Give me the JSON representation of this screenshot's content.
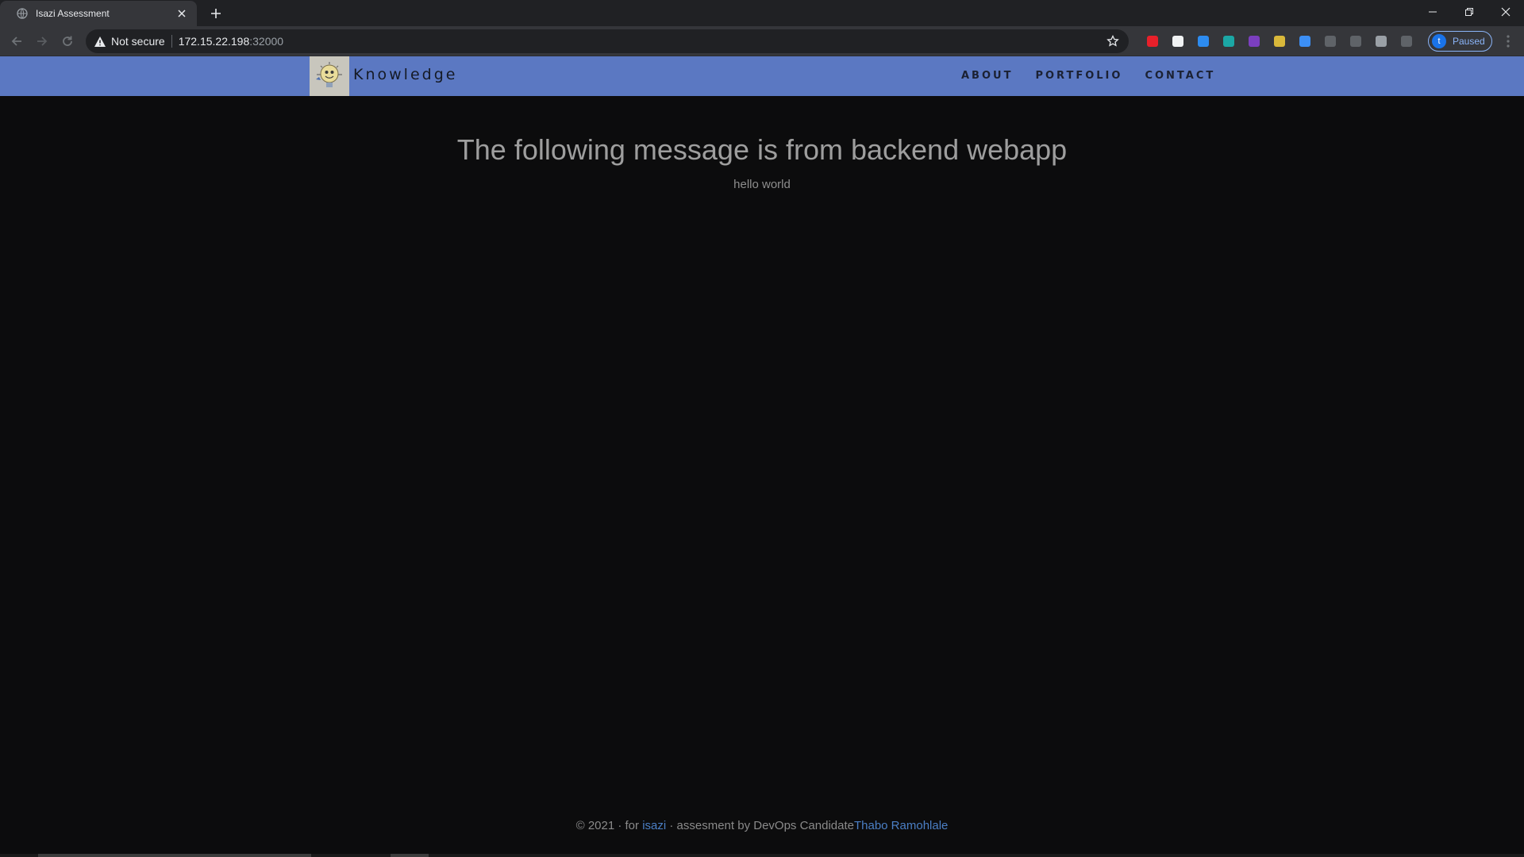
{
  "browser": {
    "tab": {
      "title": "Isazi Assessment"
    },
    "address": {
      "security_label": "Not secure",
      "host": "172.15.22.198",
      "rest": ":32000"
    },
    "profile": {
      "initial": "t",
      "status": "Paused"
    },
    "extensions": [
      {
        "name": "red-hand-extension",
        "color": "#e8202a"
      },
      {
        "name": "white-circle-extension",
        "color": "#f1f3f4"
      },
      {
        "name": "c-blue-extension",
        "color": "#2d8cf0"
      },
      {
        "name": "m-teal-extension",
        "color": "#1ba7a5"
      },
      {
        "name": "onenote-extension",
        "color": "#7b3fbf"
      },
      {
        "name": "folder-extension",
        "color": "#d9b83a"
      },
      {
        "name": "chrome-blue-extension",
        "color": "#3c8ff5"
      },
      {
        "name": "box-extension",
        "color": "#5f6368"
      },
      {
        "name": "download-extension",
        "color": "#5f6368"
      },
      {
        "name": "search-box-extension",
        "color": "#9aa0a6"
      },
      {
        "name": "puzzle-extension",
        "color": "#5f6368"
      }
    ]
  },
  "navbar": {
    "brand": "Knowledge",
    "links": [
      "ABOUT",
      "PORTFOLIO",
      "CONTACT"
    ],
    "background": "#5b78c2"
  },
  "main": {
    "headline": "The following message is from backend webapp",
    "message": "hello world"
  },
  "footer": {
    "prefix": "© 2021 · for ",
    "link1": "isazi",
    "middle": " · assesment by DevOps Candidate",
    "link2": "Thabo Ramohlale"
  }
}
